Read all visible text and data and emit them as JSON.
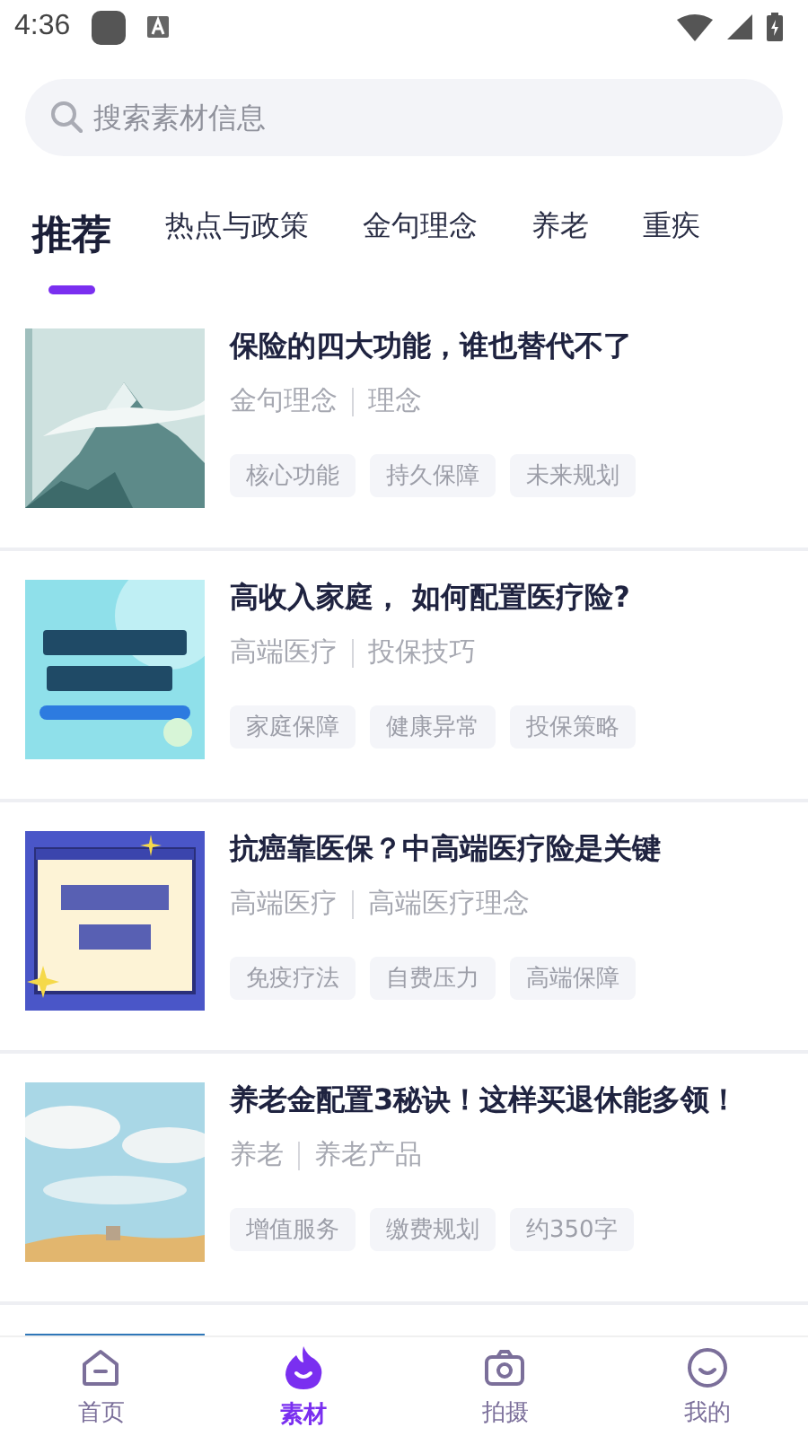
{
  "status_bar": {
    "time": "4:36"
  },
  "search": {
    "placeholder": "搜索素材信息"
  },
  "tabs": [
    {
      "label": "推荐",
      "selected": true
    },
    {
      "label": "热点与政策",
      "selected": false
    },
    {
      "label": "金句理念",
      "selected": false
    },
    {
      "label": "养老",
      "selected": false
    },
    {
      "label": "重疾",
      "selected": false
    }
  ],
  "articles": [
    {
      "title": "保险的四大功能，谁也替代不了",
      "category": "金句理念",
      "subcategory": "理念",
      "tags": [
        "核心功能",
        "持久保障",
        "未来规划"
      ]
    },
    {
      "title": "高收入家庭， 如何配置医疗险?",
      "category": "高端医疗",
      "subcategory": "投保技巧",
      "tags": [
        "家庭保障",
        "健康异常",
        "投保策略"
      ]
    },
    {
      "title": "抗癌靠医保？中高端医疗险是关键",
      "category": "高端医疗",
      "subcategory": "高端医疗理念",
      "tags": [
        "免疫疗法",
        "自费压力",
        "高端保障"
      ]
    },
    {
      "title": "养老金配置3秘诀！这样买退休能多领！",
      "category": "养老",
      "subcategory": "养老产品",
      "tags": [
        "增值服务",
        "缴费规划",
        "约350字"
      ]
    },
    {
      "kind": "picture"
    }
  ],
  "bottom_nav": [
    {
      "label": "首页",
      "selected": false
    },
    {
      "label": "素材",
      "selected": true
    },
    {
      "label": "拍摄",
      "selected": false
    },
    {
      "label": "我的",
      "selected": false
    }
  ]
}
